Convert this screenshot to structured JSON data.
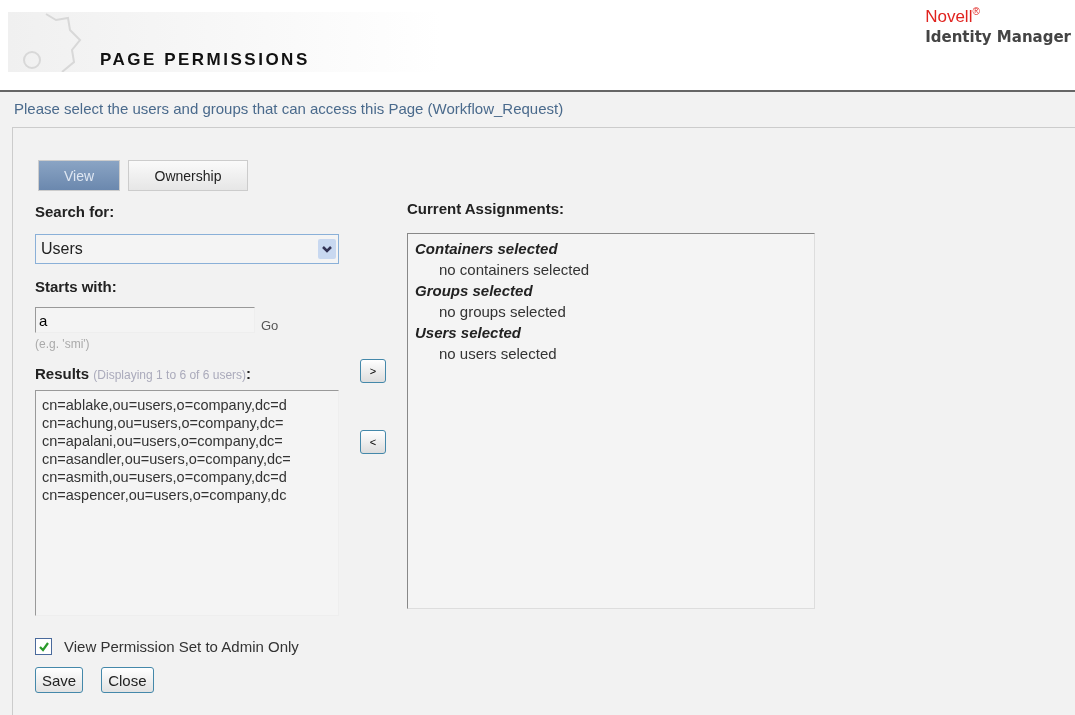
{
  "header": {
    "title": "PAGE PERMISSIONS",
    "brand": "Novell",
    "brand_mark": "®",
    "product": "Identity Manager"
  },
  "intro": "Please select the users and groups that can access this Page (Workflow_Request)",
  "tabs": [
    {
      "label": "View",
      "selected": true
    },
    {
      "label": "Ownership",
      "selected": false
    }
  ],
  "search": {
    "label": "Search for:",
    "value": "Users"
  },
  "starts_with": {
    "label": "Starts with:",
    "value": "a",
    "go": "Go",
    "hint": "(e.g. 'smi')"
  },
  "results": {
    "label": "Results",
    "note": "(Displaying 1 to 6 of 6 users)",
    "colon": ":",
    "items": [
      "cn=ablake,ou=users,o=company,dc=d",
      "cn=achung,ou=users,o=company,dc=",
      "cn=apalani,ou=users,o=company,dc=",
      "cn=asandler,ou=users,o=company,dc=",
      "cn=asmith,ou=users,o=company,dc=d",
      "cn=aspencer,ou=users,o=company,dc"
    ]
  },
  "move_buttons": [
    ">",
    "<"
  ],
  "assignments": {
    "label": "Current Assignments:",
    "groups": [
      {
        "heading": "Containers selected",
        "entry": "no containers selected"
      },
      {
        "heading": "Groups selected",
        "entry": "no groups selected"
      },
      {
        "heading": "Users selected",
        "entry": "no users selected"
      }
    ]
  },
  "admin_only": {
    "label": "View Permission Set to Admin Only",
    "checked": true
  },
  "buttons": [
    "Save",
    "Close"
  ]
}
